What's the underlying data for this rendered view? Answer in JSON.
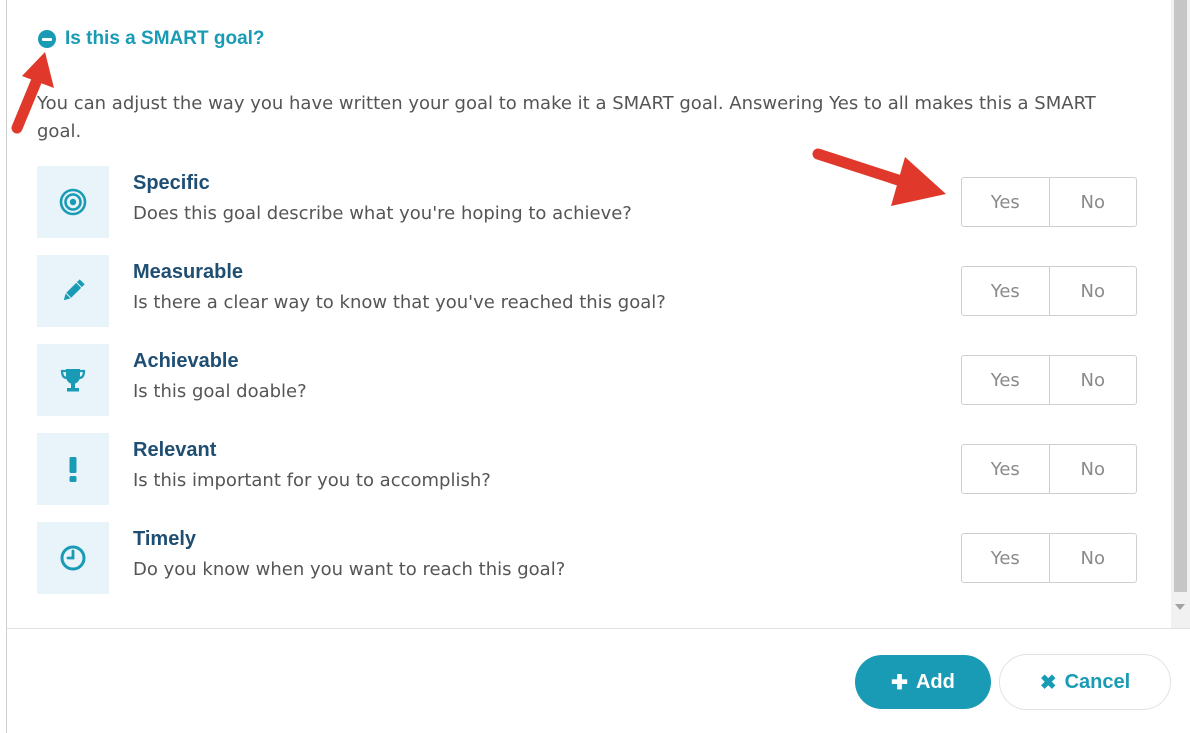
{
  "smart_toggle": {
    "label": "Is this a SMART goal?",
    "icon": "minus-circle-icon"
  },
  "intro": "You can adjust the way you have written your goal to make it a SMART goal. Answering Yes to all makes this a SMART goal.",
  "criteria": [
    {
      "title": "Specific",
      "question": "Does this goal describe what you're hoping to achieve?",
      "icon": "target-icon",
      "yes": "Yes",
      "no": "No"
    },
    {
      "title": "Measurable",
      "question": "Is there a clear way to know that you've reached this goal?",
      "icon": "pencil-icon",
      "yes": "Yes",
      "no": "No"
    },
    {
      "title": "Achievable",
      "question": "Is this goal doable?",
      "icon": "trophy-icon",
      "yes": "Yes",
      "no": "No"
    },
    {
      "title": "Relevant",
      "question": "Is this important for you to accomplish?",
      "icon": "exclamation-icon",
      "yes": "Yes",
      "no": "No"
    },
    {
      "title": "Timely",
      "question": "Do you know when you want to reach this goal?",
      "icon": "clock-icon",
      "yes": "Yes",
      "no": "No"
    }
  ],
  "actions": {
    "add_label": "Add",
    "add_icon": "plus-icon",
    "cancel_label": "Cancel",
    "cancel_icon": "x-icon"
  },
  "colors": {
    "accent": "#1a9bb5",
    "title": "#1f4e73",
    "icon_bg": "#e8f4fa",
    "annotation_arrow": "#e0392b"
  }
}
